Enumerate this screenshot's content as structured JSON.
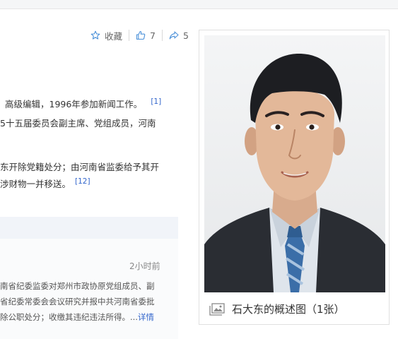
{
  "actions": {
    "collect_label": "收藏",
    "like_count": "7",
    "share_count": "5"
  },
  "article": {
    "p1_line1": "高级编辑，1996年参加新闻工作。",
    "p1_ref": "[1]",
    "p1_line2": "5十五届委员会副主席、党组成员，河南",
    "p2_line1": "东开除党籍处分；由河南省监委给予其开",
    "p2_line2": "涉财物一并移送。",
    "p2_ref": "[12]"
  },
  "news": {
    "time": "2小时前",
    "line1": "南省纪委监委对郑州市政协原党组成员、副",
    "line2": "省纪委常委会会议研究并报中共河南省委批",
    "line3": "除公职处分；收缴其违纪违法所得。...",
    "more_label": "详情"
  },
  "summary_pic": {
    "caption": "石大东的概述图（1张）"
  },
  "colors": {
    "link": "#3366cc",
    "action_icon": "#4a90d9",
    "panel_bg": "#f1f4f9"
  }
}
